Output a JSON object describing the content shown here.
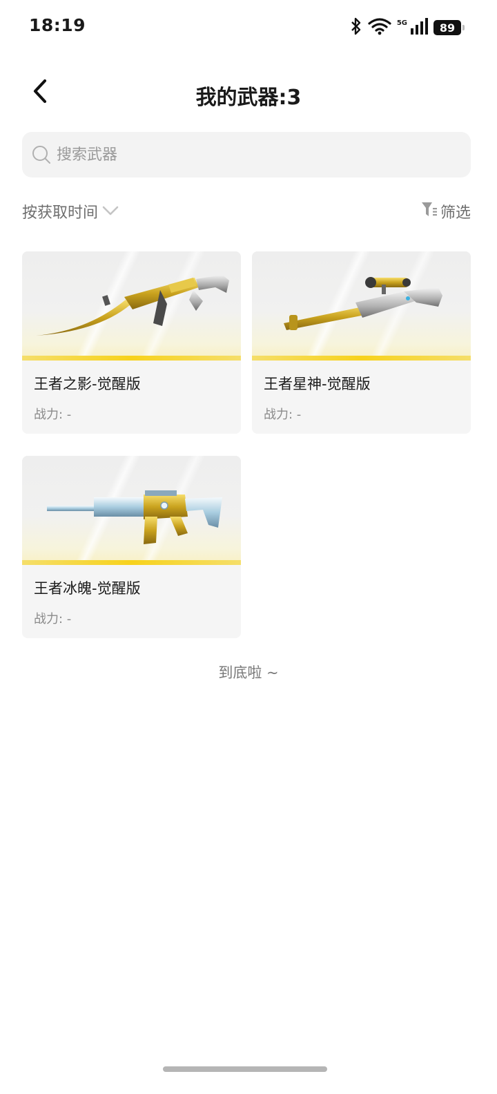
{
  "status_bar": {
    "time": "18:19",
    "network": "5G",
    "battery": "89",
    "icons": [
      "bluetooth-icon",
      "wifi-icon",
      "signal-icon",
      "battery-icon"
    ]
  },
  "header": {
    "back_icon": "chevron-left-icon",
    "title": "我的武器:3"
  },
  "search": {
    "placeholder": "搜索武器",
    "value": ""
  },
  "toolbar": {
    "sort_label": "按获取时间",
    "filter_label": "筛选"
  },
  "weapons": [
    {
      "name": "王者之影-觉醒版",
      "power": "战力: -",
      "image_icon": "rifle-ak-icon"
    },
    {
      "name": "王者星神-觉醒版",
      "power": "战力: -",
      "image_icon": "sniper-rifle-icon"
    },
    {
      "name": "王者冰魄-觉醒版",
      "power": "战力: -",
      "image_icon": "rifle-m4-icon"
    }
  ],
  "footer": {
    "end_text": "到底啦 ~"
  },
  "colors": {
    "accent_yellow": "#f7d21c",
    "card_bg": "#f5f5f5",
    "search_bg": "#f3f3f3",
    "muted_text": "#8a8a8a"
  }
}
